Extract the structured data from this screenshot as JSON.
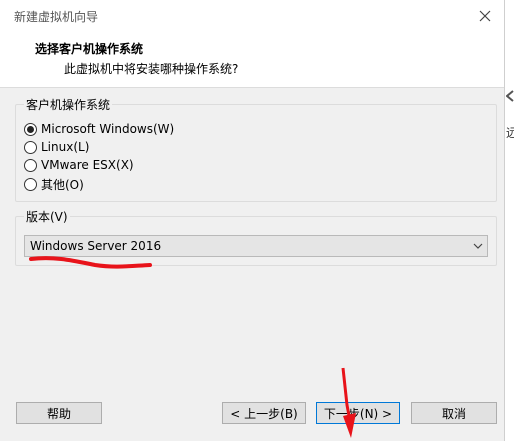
{
  "window": {
    "title": "新建虚拟机向导"
  },
  "header": {
    "title": "选择客户机操作系统",
    "subtitle": "此虚拟机中将安装哪种操作系统?"
  },
  "os_group": {
    "label": "客户机操作系统",
    "options": [
      {
        "label": "Microsoft Windows(W)",
        "selected": true
      },
      {
        "label": "Linux(L)",
        "selected": false
      },
      {
        "label": "VMware ESX(X)",
        "selected": false
      },
      {
        "label": "其他(O)",
        "selected": false
      }
    ]
  },
  "version_group": {
    "label": "版本(V)",
    "selected": "Windows Server 2016"
  },
  "buttons": {
    "help": "帮助",
    "back": "< 上一步(B)",
    "next": "下一步(N) >",
    "cancel": "取消"
  },
  "side": {
    "text": "远"
  },
  "annotation_color": "#e8131a"
}
